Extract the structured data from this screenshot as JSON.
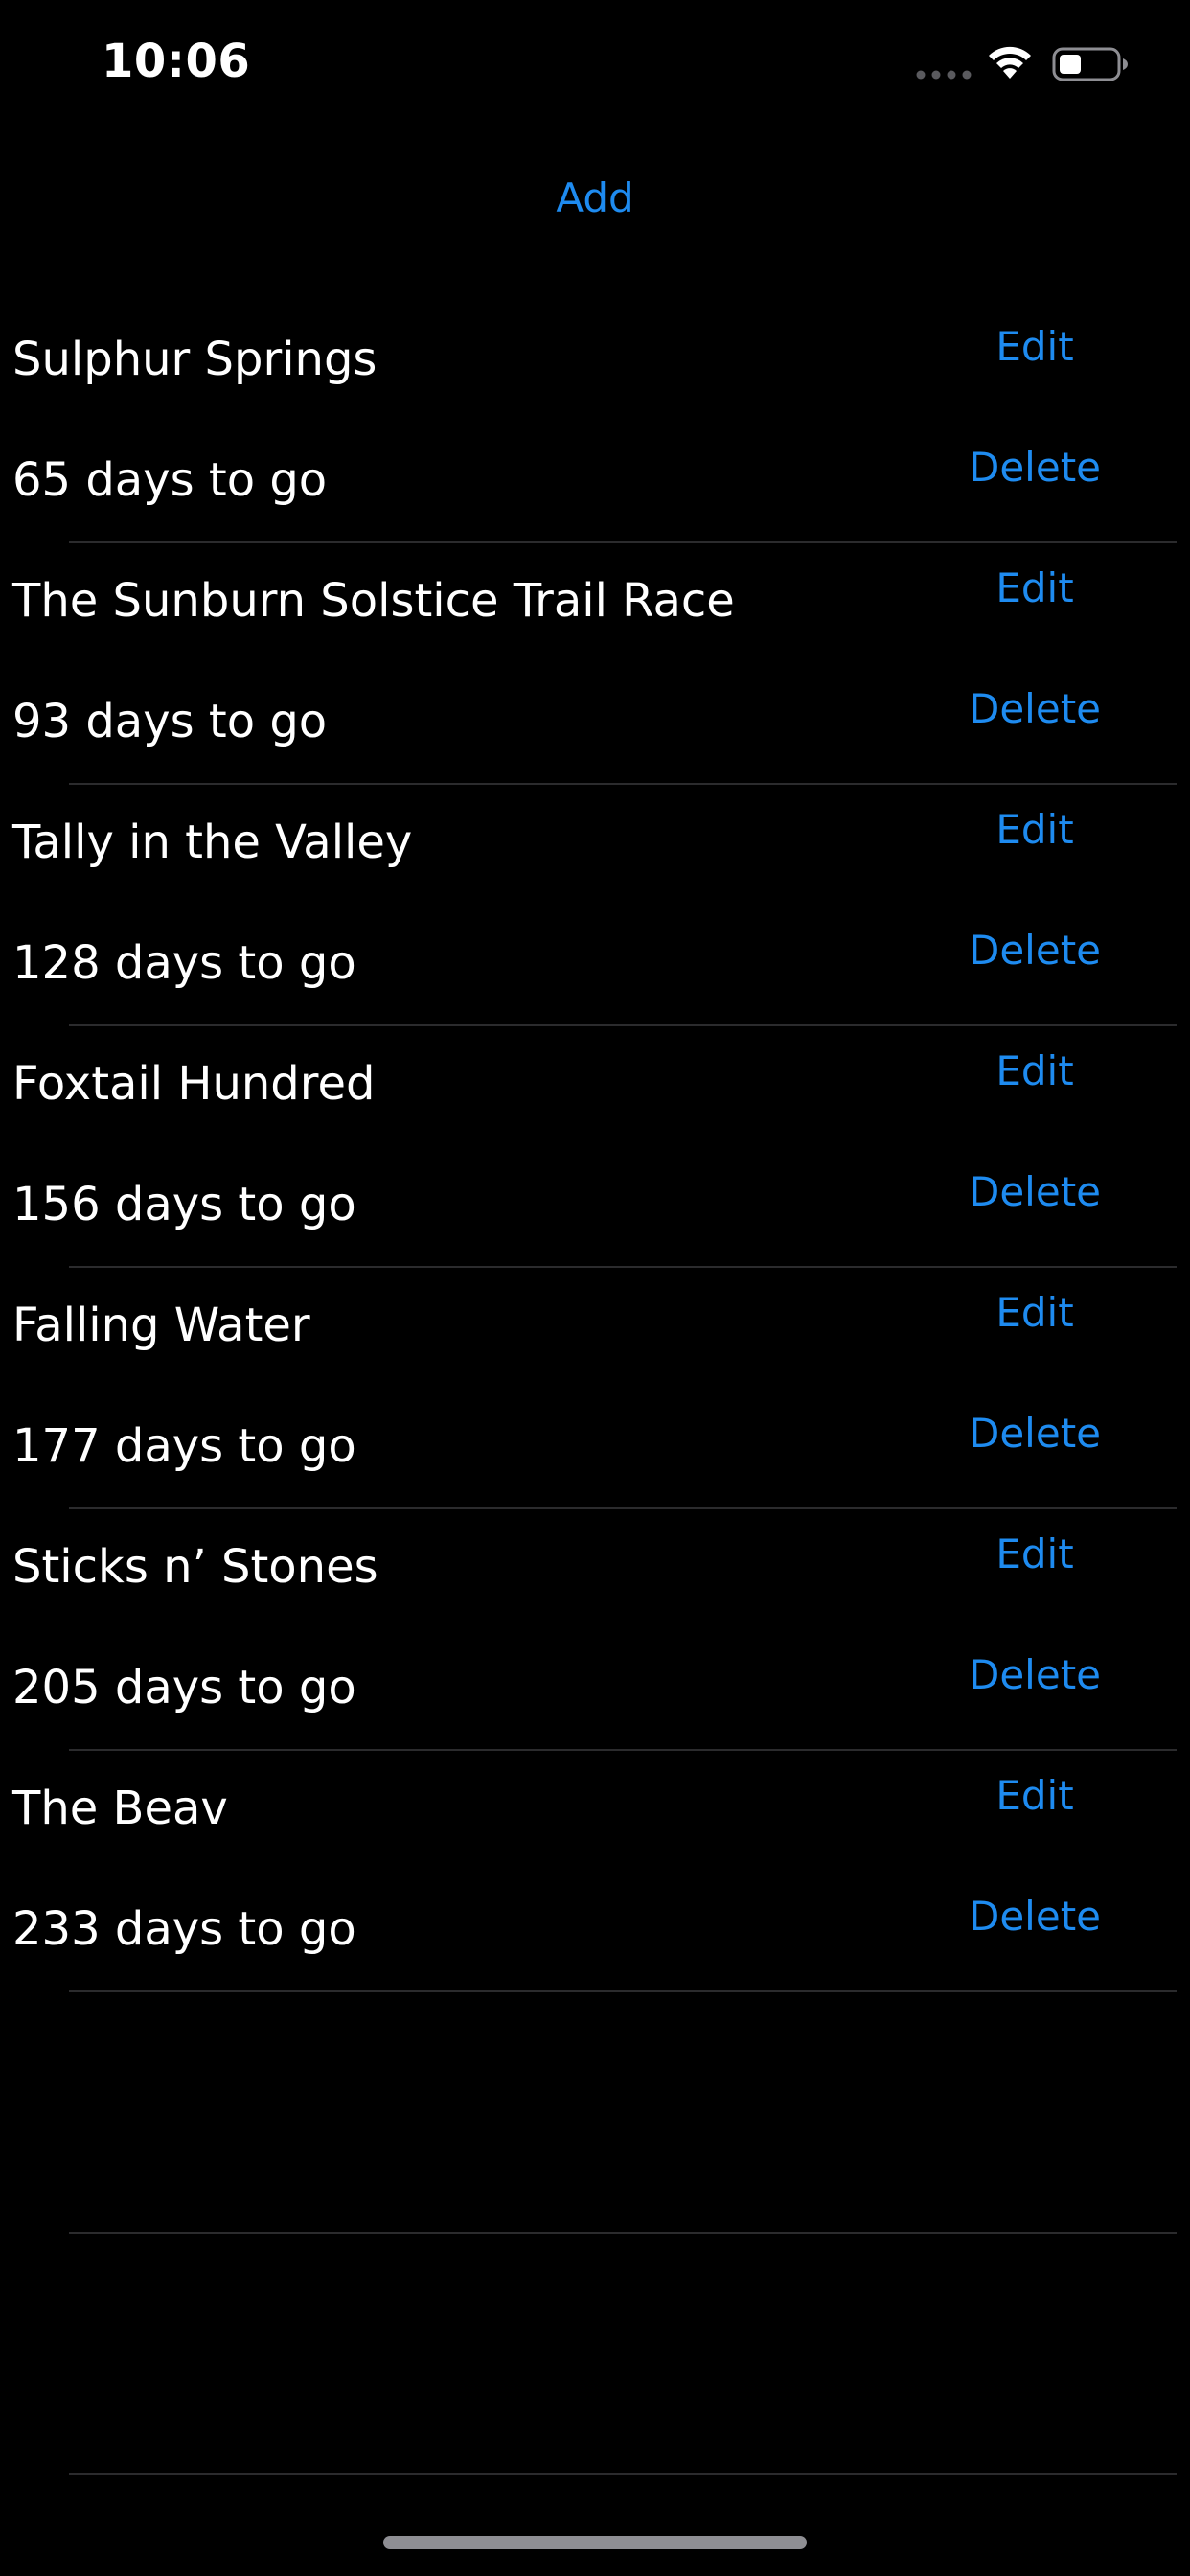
{
  "status_bar": {
    "time": "10:06",
    "icons": [
      "signal-dots-icon",
      "wifi-icon",
      "battery-icon"
    ]
  },
  "toolbar": {
    "add_label": "Add"
  },
  "races": [
    {
      "name": "Sulphur Springs",
      "days": "65 days to go",
      "edit_label": "Edit",
      "delete_label": "Delete"
    },
    {
      "name": "The Sunburn Solstice Trail Race",
      "days": "93 days to go",
      "edit_label": "Edit",
      "delete_label": "Delete"
    },
    {
      "name": "Tally in the Valley",
      "days": "128 days to go",
      "edit_label": "Edit",
      "delete_label": "Delete"
    },
    {
      "name": "Foxtail Hundred",
      "days": "156 days to go",
      "edit_label": "Edit",
      "delete_label": "Delete"
    },
    {
      "name": "Falling Water",
      "days": "177 days to go",
      "edit_label": "Edit",
      "delete_label": "Delete"
    },
    {
      "name": "Sticks n’ Stones",
      "days": "205 days to go",
      "edit_label": "Edit",
      "delete_label": "Delete"
    },
    {
      "name": "The Beav",
      "days": "233 days to go",
      "edit_label": "Edit",
      "delete_label": "Delete"
    }
  ],
  "colors": {
    "accent": "#1e8bf0",
    "background": "#000000",
    "separator": "#2b2b2d",
    "text": "#ffffff"
  }
}
